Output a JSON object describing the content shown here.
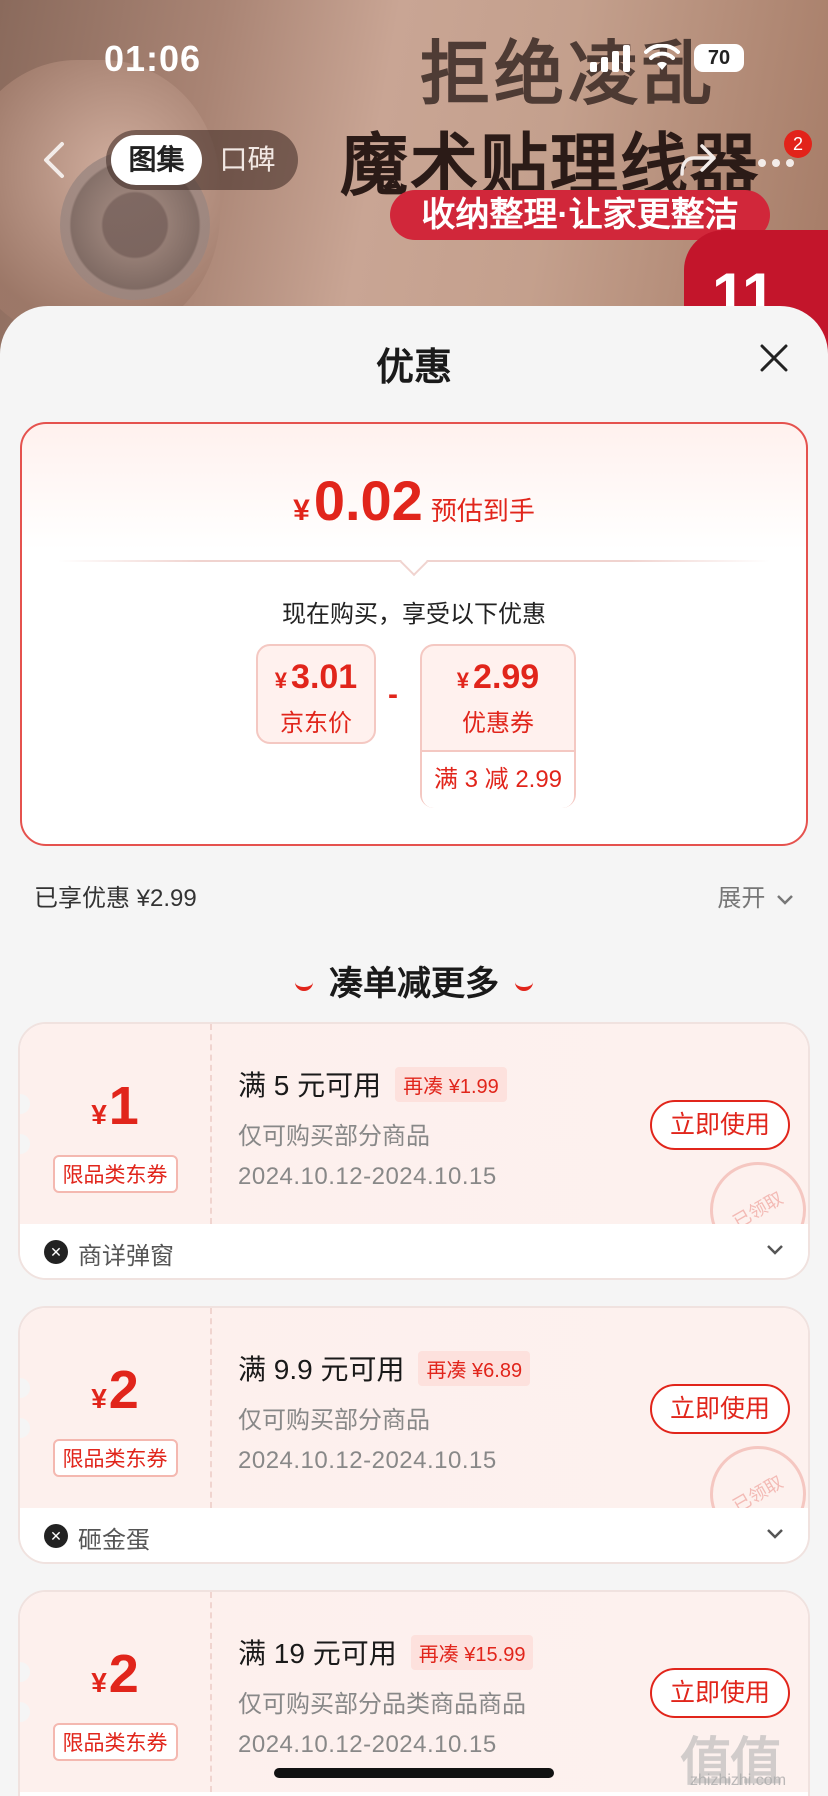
{
  "status_bar": {
    "time": "01:06",
    "battery": "70"
  },
  "banner": {
    "title_line1": "拒绝凌乱",
    "title_line2": "魔术贴理线器",
    "subtitle": "收纳整理·让家更整洁",
    "promo_mark": "11"
  },
  "nav": {
    "segments": [
      "图集",
      "口碑"
    ],
    "active_segment": "图集",
    "more_badge": "2"
  },
  "sheet": {
    "title": "优惠",
    "estimate": {
      "currency": "¥",
      "price": "0.02",
      "label": "预估到手"
    },
    "buy_now": "现在购买，享受以下优惠",
    "jd_price": {
      "currency": "¥",
      "value": "3.01",
      "label": "京东价"
    },
    "operator": "-",
    "coupon_price": {
      "currency": "¥",
      "value": "2.99",
      "label": "优惠券",
      "condition": "满 3 减 2.99"
    },
    "enjoyed": "已享优惠 ¥2.99",
    "expand": "展开",
    "section_title": "凑单减更多"
  },
  "coupons": [
    {
      "currency": "¥",
      "amount": "1",
      "tag": "限品类东券",
      "condition": "满 5 元可用",
      "extra": "再凑 ¥1.99",
      "desc": "仅可购买部分商品",
      "date": "2024.10.12-2024.10.15",
      "button": "立即使用",
      "stamp": "已领取",
      "source": "商详弹窗"
    },
    {
      "currency": "¥",
      "amount": "2",
      "tag": "限品类东券",
      "condition": "满 9.9 元可用",
      "extra": "再凑 ¥6.89",
      "desc": "仅可购买部分商品",
      "date": "2024.10.12-2024.10.15",
      "button": "立即使用",
      "stamp": "已领取",
      "source": "砸金蛋"
    },
    {
      "currency": "¥",
      "amount": "2",
      "tag": "限品类东券",
      "condition": "满 19 元可用",
      "extra": "再凑 ¥15.99",
      "desc": "仅可购买部分品类商品商品",
      "date": "2024.10.12-2024.10.15",
      "button": "立即使用"
    }
  ],
  "watermark": {
    "logo": "值值值",
    "site": "zhizhizhi.com"
  },
  "colors": {
    "accent": "#e1251b",
    "border": "#e5524e",
    "sheet_bg": "#f5f5f5"
  }
}
